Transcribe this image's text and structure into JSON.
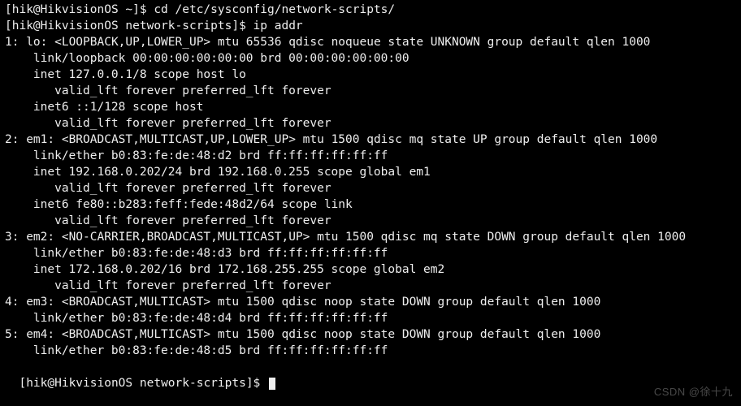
{
  "prompt1": "[hik@HikvisionOS ~]$ cd /etc/sysconfig/network-scripts/",
  "prompt2": "[hik@HikvisionOS network-scripts]$ ip addr",
  "if1": {
    "hdr": "1: lo: <LOOPBACK,UP,LOWER_UP> mtu 65536 qdisc noqueue state UNKNOWN group default qlen 1000",
    "link": "link/loopback 00:00:00:00:00:00 brd 00:00:00:00:00:00",
    "inet": "inet 127.0.0.1/8 scope host lo",
    "valid1": "valid_lft forever preferred_lft forever",
    "inet6": "inet6 ::1/128 scope host",
    "valid2": "valid_lft forever preferred_lft forever"
  },
  "if2": {
    "hdr": "2: em1: <BROADCAST,MULTICAST,UP,LOWER_UP> mtu 1500 qdisc mq state UP group default qlen 1000",
    "link": "link/ether b0:83:fe:de:48:d2 brd ff:ff:ff:ff:ff:ff",
    "inet": "inet 192.168.0.202/24 brd 192.168.0.255 scope global em1",
    "valid1": "valid_lft forever preferred_lft forever",
    "inet6": "inet6 fe80::b283:feff:fede:48d2/64 scope link",
    "valid2": "valid_lft forever preferred_lft forever"
  },
  "if3": {
    "hdr": "3: em2: <NO-CARRIER,BROADCAST,MULTICAST,UP> mtu 1500 qdisc mq state DOWN group default qlen 1000",
    "link": "link/ether b0:83:fe:de:48:d3 brd ff:ff:ff:ff:ff:ff",
    "inet": "inet 172.168.0.202/16 brd 172.168.255.255 scope global em2",
    "valid1": "valid_lft forever preferred_lft forever"
  },
  "if4": {
    "hdr": "4: em3: <BROADCAST,MULTICAST> mtu 1500 qdisc noop state DOWN group default qlen 1000",
    "link": "link/ether b0:83:fe:de:48:d4 brd ff:ff:ff:ff:ff:ff"
  },
  "if5": {
    "hdr": "5: em4: <BROADCAST,MULTICAST> mtu 1500 qdisc noop state DOWN group default qlen 1000",
    "link": "link/ether b0:83:fe:de:48:d5 brd ff:ff:ff:ff:ff:ff"
  },
  "prompt3": "[hik@HikvisionOS network-scripts]$ ",
  "watermark": "CSDN @徐十九"
}
